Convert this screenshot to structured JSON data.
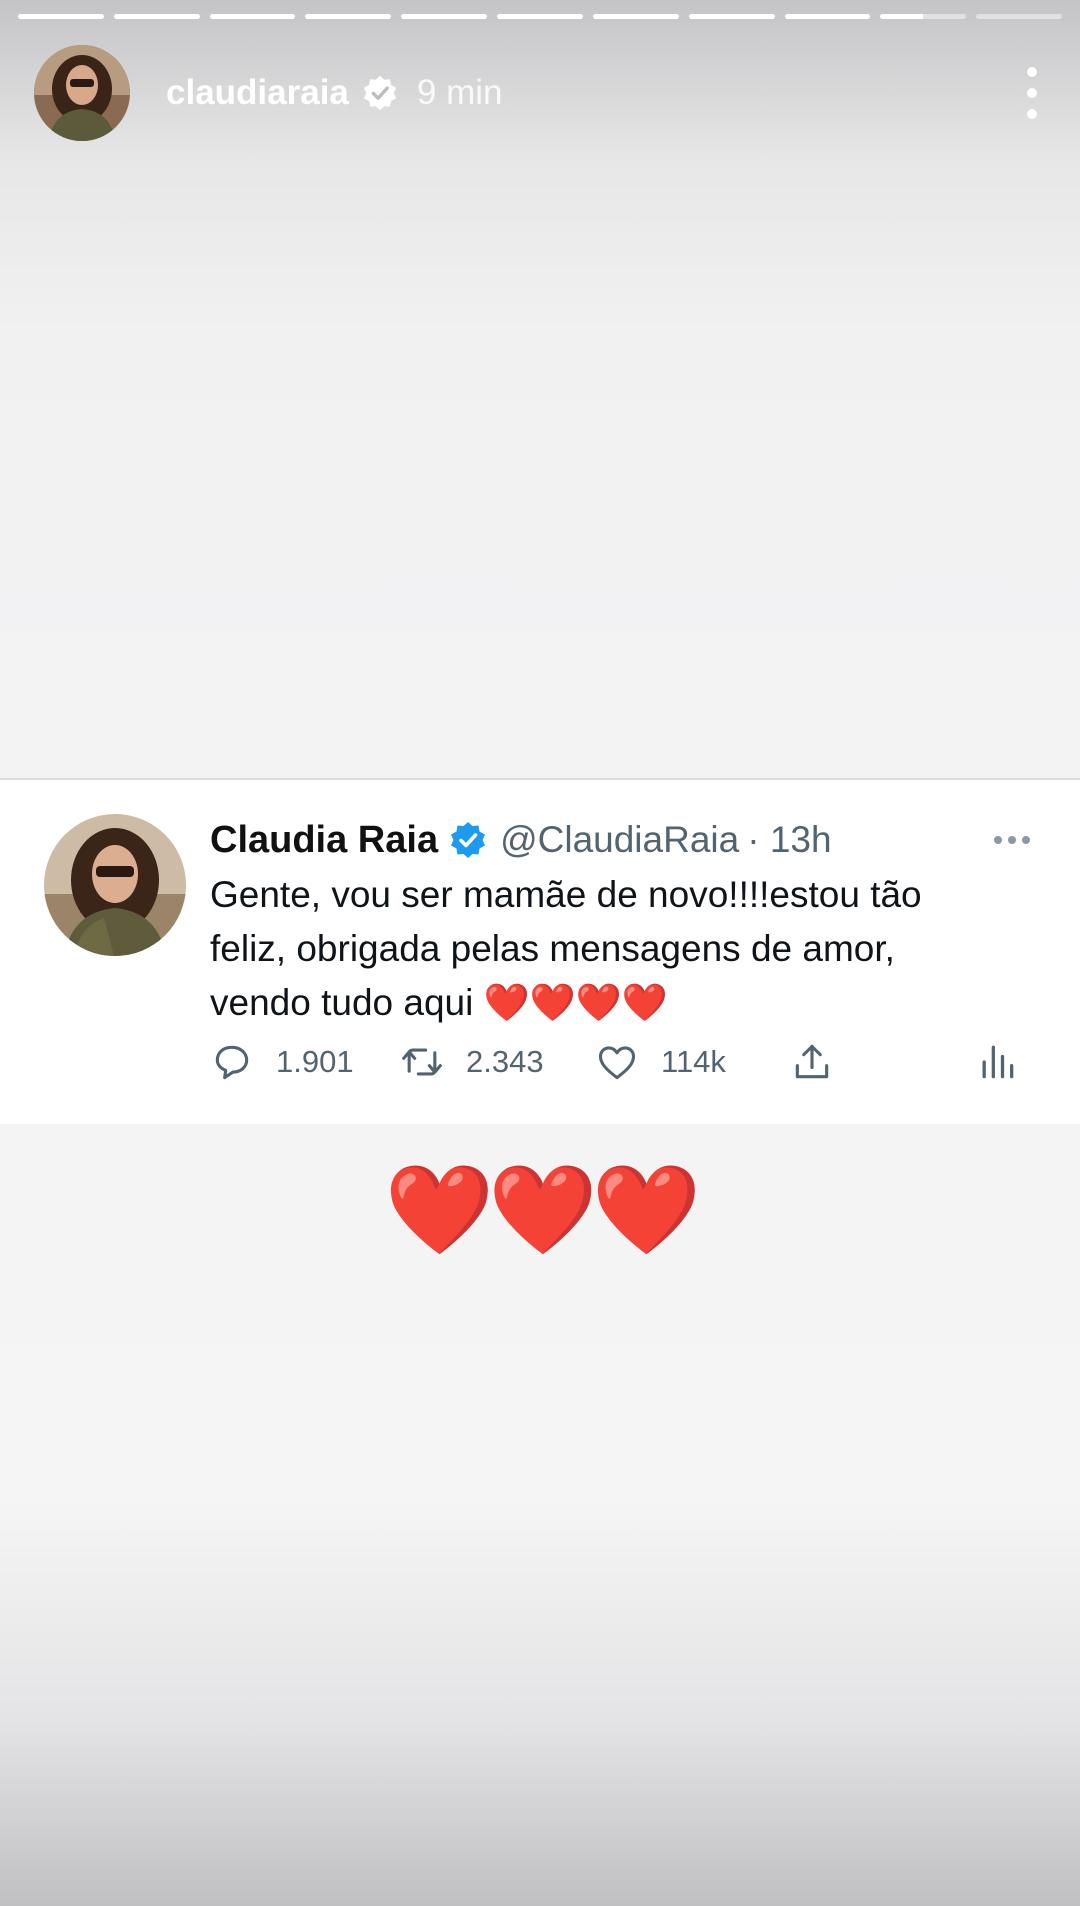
{
  "story": {
    "segments": [
      1,
      1,
      1,
      1,
      1,
      1,
      1,
      1,
      1,
      0.5,
      0
    ],
    "username": "claudiaraia",
    "time_ago": "9 min"
  },
  "tweet": {
    "display_name": "Claudia Raia",
    "handle": "@ClaudiaRaia",
    "time": "· 13h",
    "text": "Gente, vou ser mamãe de novo!!!!estou tão\nfeliz, obrigada pelas mensagens de amor,\nvendo tudo aqui ❤️❤️❤️❤️",
    "replies": "1.901",
    "retweets": "2.343",
    "likes": "114k"
  },
  "sticker": {
    "hearts": "❤️❤️❤️"
  },
  "icons": [
    "verified-badge-icon",
    "more-vertical-icon",
    "reply-icon",
    "retweet-icon",
    "like-icon",
    "share-icon",
    "analytics-icon",
    "more-horizontal-icon"
  ],
  "colors": {
    "verified_blue": "#1d9bf0",
    "heart_red": "#e0182d",
    "secondary_text": "#536471"
  }
}
